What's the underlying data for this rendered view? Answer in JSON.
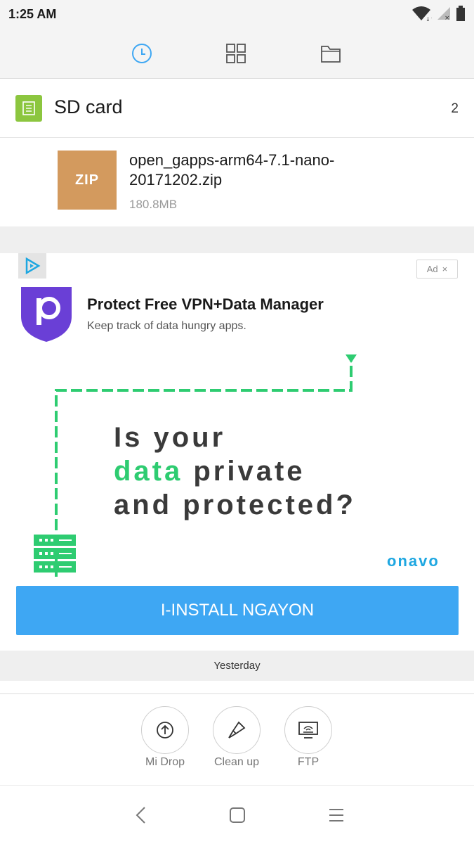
{
  "status_bar": {
    "time": "1:25 AM",
    "icons": [
      "wifi-icon",
      "signal-icon",
      "battery-icon"
    ]
  },
  "tabs": [
    {
      "name": "recent",
      "icon": "clock-icon",
      "active": true
    },
    {
      "name": "categories",
      "icon": "grid-icon",
      "active": false
    },
    {
      "name": "folders",
      "icon": "folder-icon",
      "active": false
    }
  ],
  "section": {
    "title": "SD card",
    "count": "2",
    "icon": "sd-card-icon"
  },
  "file": {
    "type_label": "ZIP",
    "name": "open_gapps-arm64-7.1-nano-20171202.zip",
    "size": "180.8MB"
  },
  "ad": {
    "badge": "Ad",
    "close": "×",
    "title": "Protect Free VPN+Data Manager",
    "description": "Keep track of data hungry apps.",
    "headline_1": "Is your",
    "headline_2_green": "data",
    "headline_2_rest": " private",
    "headline_3": "and protected?",
    "brand": "onavo",
    "cta": "I-INSTALL NGAYON",
    "colors": {
      "accent": "#3ea7f3",
      "green": "#2ecc71",
      "logo": "#6a3fd6"
    }
  },
  "divider": {
    "label": "Yesterday"
  },
  "tools": [
    {
      "label": "Mi Drop",
      "icon": "upload-icon"
    },
    {
      "label": "Clean up",
      "icon": "brush-icon"
    },
    {
      "label": "FTP",
      "icon": "computer-icon"
    }
  ],
  "nav": [
    "back-icon",
    "home-icon",
    "menu-icon"
  ]
}
